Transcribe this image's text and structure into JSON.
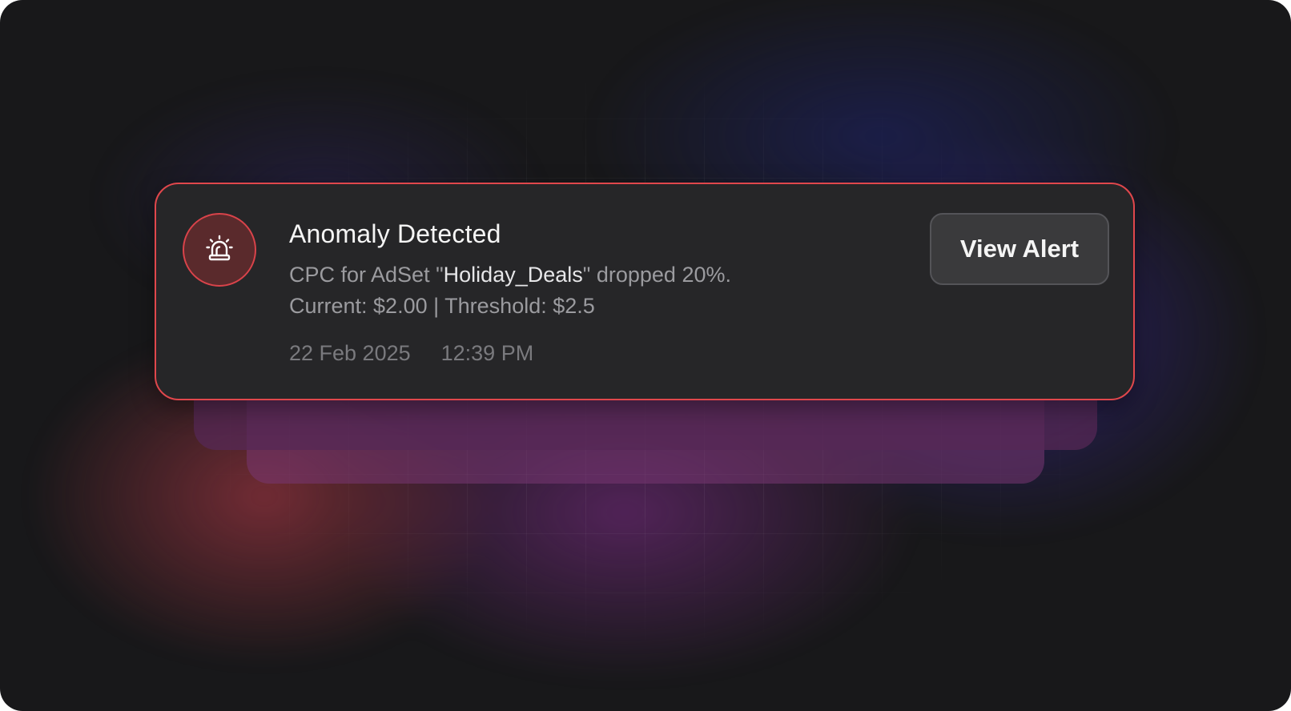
{
  "alert": {
    "icon": "siren-icon",
    "title": "Anomaly Detected",
    "message_prefix": "CPC for AdSet \"",
    "adset_name": "Holiday_Deals",
    "message_suffix": "\" dropped 20%.",
    "current_label": "Current: $2.00",
    "separator": "|",
    "threshold_label": "Threshold: $2.5",
    "date": "22 Feb 2025",
    "time": "12:39 PM",
    "button_label": "View Alert"
  },
  "colors": {
    "background": "#18181a",
    "card": "#262628",
    "alert_border": "#e0474c",
    "icon_badge": "#5a2a2c",
    "button": "#3a3a3c"
  }
}
